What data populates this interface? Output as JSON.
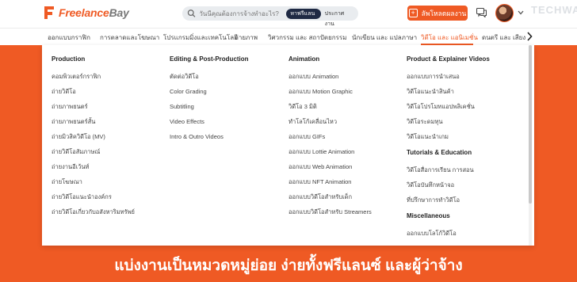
{
  "brand": {
    "name_part1": "Freelance",
    "name_part2": "Bay",
    "color": "#ef5a24"
  },
  "search": {
    "placeholder": "วันนี้คุณต้องการจ้างทำอะไร?",
    "modes": [
      "หาฟรีแลนซ์",
      "ประกาศงาน"
    ],
    "active_mode_index": 0
  },
  "header": {
    "post_job_label": "ลัพโหลดผลงาน",
    "watermark": "TECHWARE"
  },
  "nav": {
    "items": [
      "ออกแบบกราฟิก",
      "การตลาดและโฆษณา",
      "โปรแกรมมิ่งและเทคโนโลยี",
      "ถ่ายภาพ",
      "วิศวกรรม และ สถาปัตยกรรม",
      "นักเขียน และ แปลภาษา",
      "วิดีโอ และ แอนิเมชั่น",
      "ดนตรี และ เสียง"
    ],
    "active_index": 6
  },
  "dropdown": {
    "columns": [
      {
        "groups": [
          {
            "title": "Production",
            "items": [
              "คอมพิวเตอร์กราฟิก",
              "ถ่ายวิดีโอ",
              "ถ่ายภาพยนตร์",
              "ถ่ายภาพยนตร์สั้น",
              "ถ่ายมิวสิควิดีโอ (MV)",
              "ถ่ายวิดีโอสัมภาษณ์",
              "ถ่ายงานอีเว้นท์",
              "ถ่ายโฆษณา",
              "ถ่ายวิดีโอแนะนำองค์กร",
              "ถ่ายวิดีโอเกี่ยวกับอสังหาริมทรัพย์"
            ]
          }
        ]
      },
      {
        "groups": [
          {
            "title": "Editing & Post-Production",
            "items": [
              "ตัดต่อวิดีโอ",
              "Color Grading",
              "Subtitling",
              "Video Effects",
              "Intro & Outro Videos"
            ]
          }
        ]
      },
      {
        "groups": [
          {
            "title": "Animation",
            "items": [
              "ออกแบบ Animation",
              "ออกแบบ Motion Graphic",
              "วิดีโอ 3 มิติ",
              "ทำโลโก้เคลื่อนไหว",
              "ออกแบบ GIFs",
              "ออกแบบ Lottie Animation",
              "ออกแบบ Web Animation",
              "ออกแบบ NFT Animation",
              "ออกแบบวิดีโอสำหรับเด็ก",
              "ออกแบบวิดีโอสำหรับ Streamers"
            ]
          }
        ]
      },
      {
        "groups": [
          {
            "title": "Product & Explainer Videos",
            "items": [
              "ออกแบบการนำเสนอ",
              "วิดีโอแนะนำสินค้า",
              "วิดีโอโปรโมทแอปพลิเคชั่น",
              "วิดีโอระดมทุน",
              "วิดีโอแนะนำเกม"
            ]
          },
          {
            "title": "Tutorials & Education",
            "items": [
              "วิดีโอสื่อการเรียน การสอน",
              "วิดีโอบันทึกหน้าจอ",
              "ที่ปรึกษาการทำวิดีโอ"
            ]
          },
          {
            "title": "Miscellaneous",
            "items": [
              "ออกแบบโลโก้วิดีโอ"
            ]
          }
        ]
      }
    ]
  },
  "tagline": "แบ่งงานเป็นหมวดหมู่ย่อย ง่ายทั้งฟรีแลนซ์ และผู้ว่าจ้าง"
}
